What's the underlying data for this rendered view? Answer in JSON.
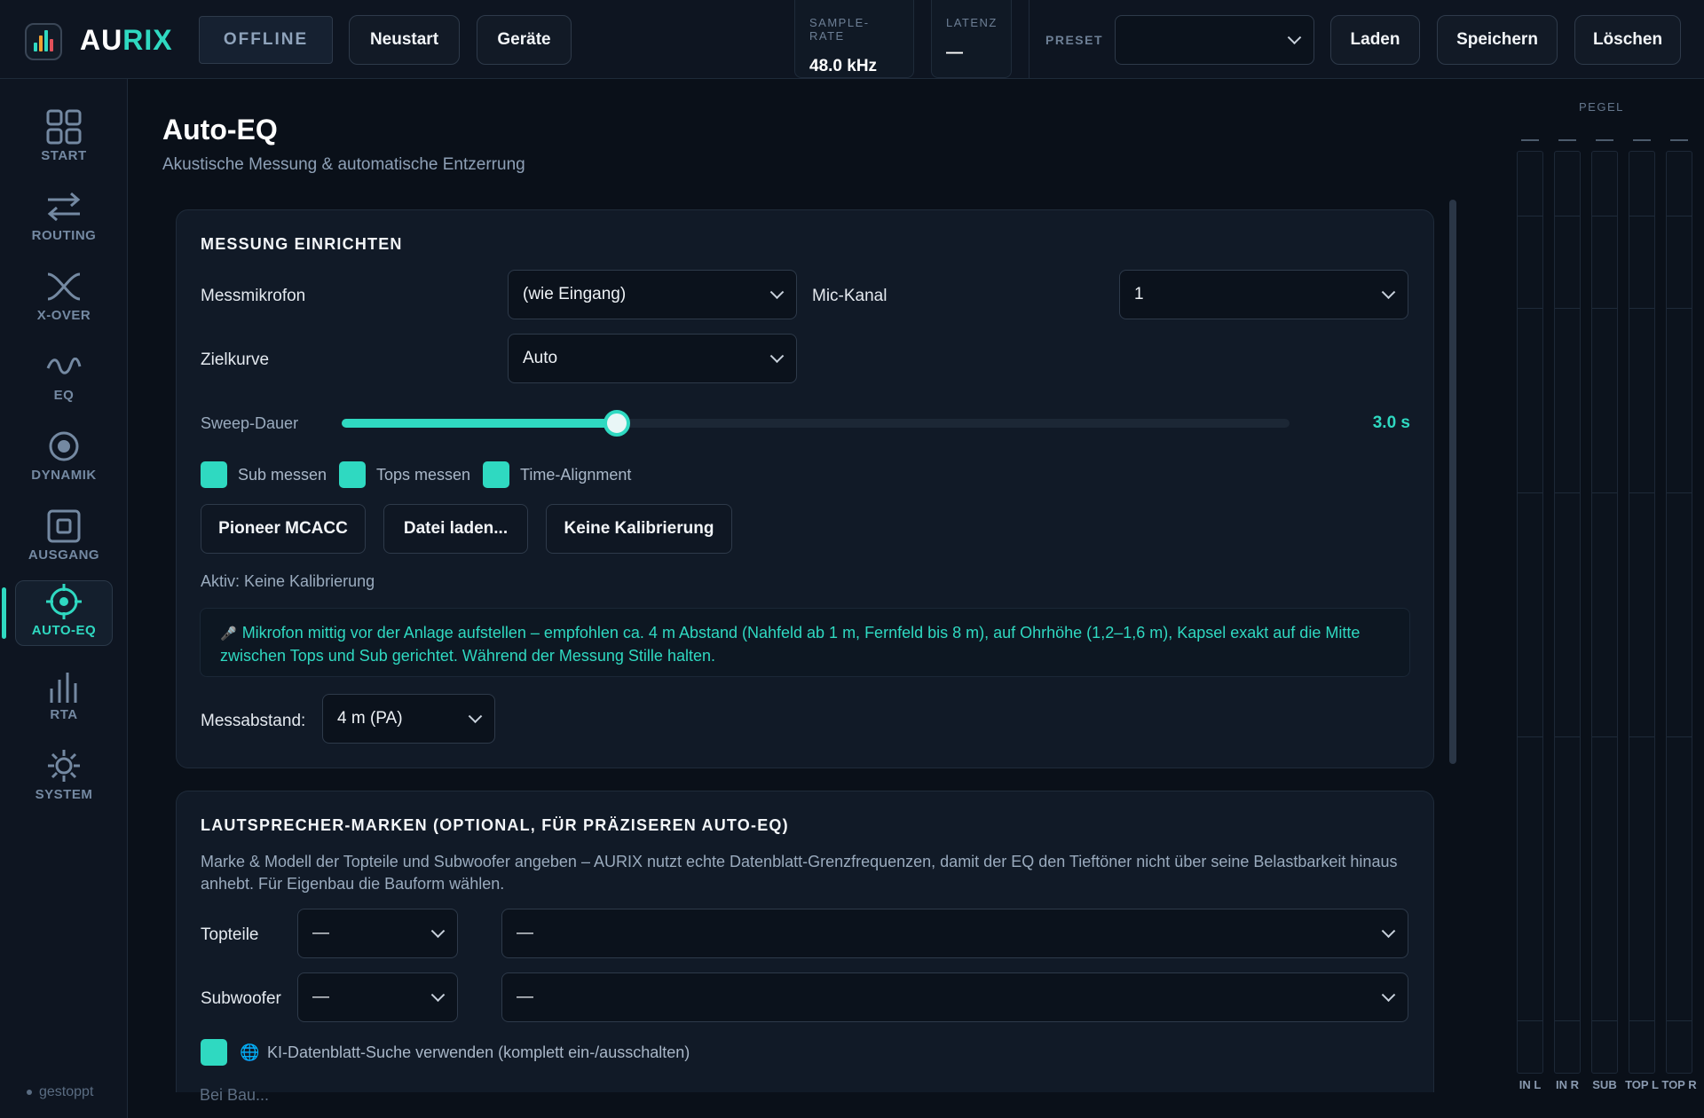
{
  "app": {
    "brand_prefix": "AU",
    "brand_accent": "RIX",
    "accent_color": "#2fd9c1",
    "status": "gestoppt"
  },
  "header": {
    "mode": "OFFLINE",
    "restart_label": "Neustart",
    "devices_label": "Geräte",
    "sample_rate": {
      "label": "SAMPLE-RATE",
      "value": "48.0 kHz"
    },
    "latency": {
      "label": "LATENZ",
      "value": "—"
    },
    "preset_label": "PRESET",
    "preset_value": "",
    "load_label": "Laden",
    "save_label": "Speichern",
    "delete_label": "Löschen"
  },
  "nav": [
    {
      "label": "START",
      "icon": "grid-icon"
    },
    {
      "label": "ROUTING",
      "icon": "arrows-swap-icon"
    },
    {
      "label": "X-OVER",
      "icon": "crossover-icon"
    },
    {
      "label": "EQ",
      "icon": "wave-icon"
    },
    {
      "label": "DYNAMIK",
      "icon": "dynamics-icon"
    },
    {
      "label": "AUSGANG",
      "icon": "output-icon"
    },
    {
      "label": "AUTO-EQ",
      "icon": "target-icon",
      "active": true
    },
    {
      "label": "RTA",
      "icon": "bars-icon"
    },
    {
      "label": "SYSTEM",
      "icon": "sun-gear-icon"
    }
  ],
  "page": {
    "title": "Auto-EQ",
    "subtitle": "Akustische Messung & automatische Entzerrung"
  },
  "measure": {
    "title": "MESSUNG EINRICHTEN",
    "mic_label": "Messmikrofon",
    "mic_value": "(wie Eingang)",
    "mic_channel_label": "Mic-Kanal",
    "mic_channel_value": "1",
    "target_label": "Zielkurve",
    "target_value": "Auto",
    "sweep_label": "Sweep-Dauer",
    "sweep_value": "3.0 s",
    "sweep_fraction": 0.29,
    "checkboxes": [
      {
        "label": "Sub messen",
        "checked": true
      },
      {
        "label": "Tops messen",
        "checked": true
      },
      {
        "label": "Time-Alignment",
        "checked": true
      }
    ],
    "calib_buttons": [
      "Pioneer MCACC",
      "Datei laden...",
      "Keine Kalibrierung"
    ],
    "active_calib": "Aktiv: Keine Kalibrierung",
    "note_icon": "🎤",
    "note": "Mikrofon mittig vor der Anlage aufstellen – empfohlen ca. 4 m Abstand (Nahfeld ab 1 m, Fernfeld bis 8 m), auf Ohrhöhe (1,2–1,6 m), Kapsel exakt auf die Mitte zwischen Tops und Sub gerichtet. Während der Messung Stille halten.",
    "distance_label": "Messabstand:",
    "distance_value": "4 m (PA)"
  },
  "speakers": {
    "title": "LAUTSPRECHER-MARKEN (OPTIONAL, FÜR PRÄZISEREN AUTO-EQ)",
    "description": "Marke & Modell der Topteile und Subwoofer angeben – AURIX nutzt echte Datenblatt-Grenzfrequenzen, damit der EQ den Tieftöner nicht über seine Belastbarkeit hinaus anhebt. Für Eigenbau die Bauform wählen.",
    "tops_label": "Topteile",
    "tops_brand": "—",
    "tops_model": "—",
    "sub_label": "Subwoofer",
    "sub_brand": "—",
    "sub_model": "—",
    "ai_icon": "🌐",
    "ai_label": "KI-Datenblatt-Suche verwenden (komplett ein-/ausschalten)",
    "cut_text": "Bei Bau..."
  },
  "meters": {
    "title": "PEGEL",
    "channels": [
      "IN L",
      "IN R",
      "SUB",
      "TOP L",
      "TOP R"
    ],
    "values": [
      "—",
      "—",
      "—",
      "—",
      "—"
    ]
  }
}
